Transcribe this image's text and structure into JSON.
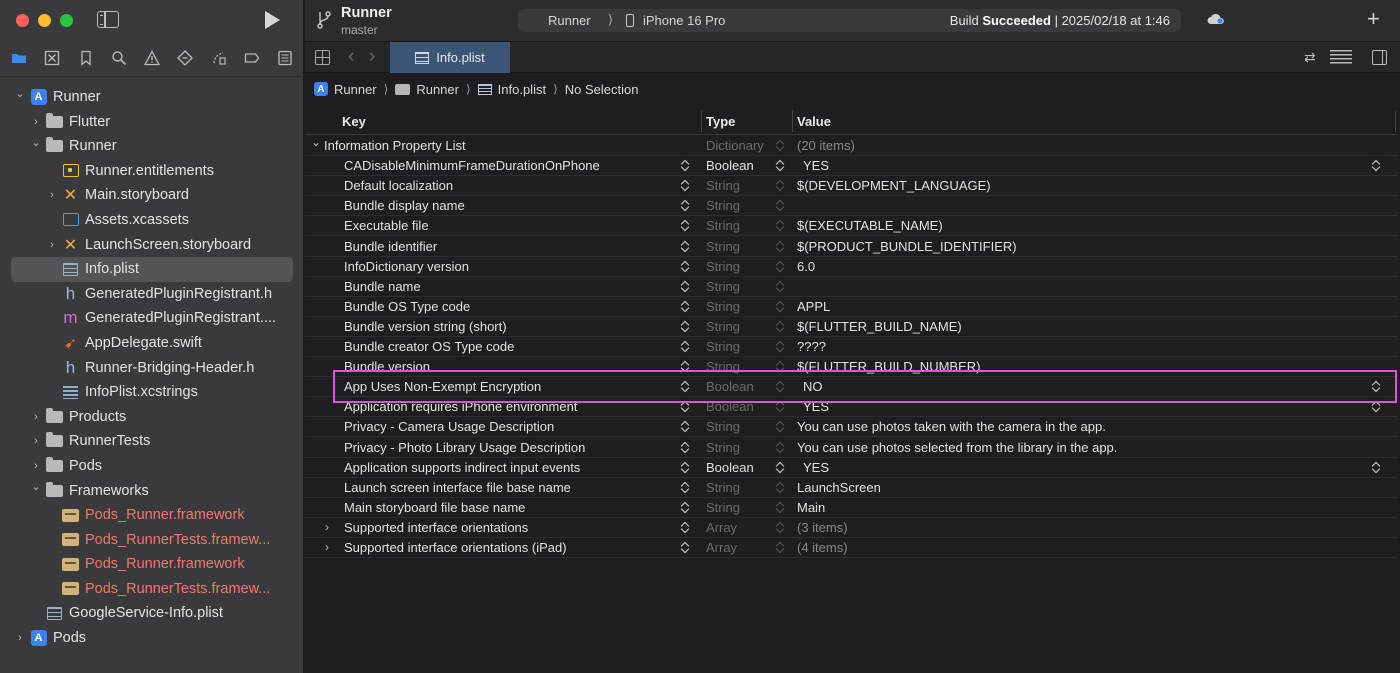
{
  "toolbar": {
    "project_name": "Runner",
    "branch": "master",
    "scheme": "Runner",
    "scheme_separator": "⟩",
    "device": "iPhone 16 Pro",
    "build_prefix": "Build ",
    "build_result": "Succeeded",
    "build_suffix": " | 2025/02/18 at 1:46",
    "add_symbol": "+"
  },
  "tab": {
    "label": "Info.plist"
  },
  "breadcrumb": {
    "items": [
      "Runner",
      "Runner",
      "Info.plist",
      "No Selection"
    ],
    "separator": "⟩"
  },
  "tree": [
    {
      "label": "Runner",
      "icon": "project-icon",
      "chevron": "v"
    },
    {
      "label": "Flutter",
      "icon": "folder-icon",
      "chevron": ">"
    },
    {
      "label": "Runner",
      "icon": "folder-icon",
      "chevron": "v"
    },
    {
      "label": "Runner.entitlements",
      "icon": "entitlements-icon",
      "chevron": ""
    },
    {
      "label": "Main.storyboard",
      "icon": "storyboard-icon",
      "chevron": ">"
    },
    {
      "label": "Assets.xcassets",
      "icon": "assets-icon",
      "chevron": ""
    },
    {
      "label": "LaunchScreen.storyboard",
      "icon": "storyboard-icon",
      "chevron": ">"
    },
    {
      "label": "Info.plist",
      "icon": "plist-icon",
      "chevron": ""
    },
    {
      "label": "GeneratedPluginRegistrant.h",
      "icon": "header-file-icon",
      "chevron": ""
    },
    {
      "label": "GeneratedPluginRegistrant....",
      "icon": "objc-file-icon",
      "chevron": ""
    },
    {
      "label": "AppDelegate.swift",
      "icon": "swift-file-icon",
      "chevron": ""
    },
    {
      "label": "Runner-Bridging-Header.h",
      "icon": "header-file-icon",
      "chevron": ""
    },
    {
      "label": "InfoPlist.xcstrings",
      "icon": "string-catalog-icon",
      "chevron": ""
    },
    {
      "label": "Products",
      "icon": "folder-icon",
      "chevron": ">"
    },
    {
      "label": "RunnerTests",
      "icon": "folder-icon",
      "chevron": ">"
    },
    {
      "label": "Pods",
      "icon": "folder-icon",
      "chevron": ">"
    },
    {
      "label": "Frameworks",
      "icon": "folder-icon",
      "chevron": "v"
    },
    {
      "label": "Pods_Runner.framework",
      "icon": "framework-icon",
      "chevron": ""
    },
    {
      "label": "Pods_RunnerTests.framew...",
      "icon": "framework-icon",
      "chevron": ""
    },
    {
      "label": "Pods_Runner.framework",
      "icon": "framework-icon",
      "chevron": ""
    },
    {
      "label": "Pods_RunnerTests.framew...",
      "icon": "framework-icon",
      "chevron": ""
    },
    {
      "label": "GoogleService-Info.plist",
      "icon": "plist-icon",
      "chevron": ""
    },
    {
      "label": "Pods",
      "icon": "project-icon",
      "chevron": ">"
    }
  ],
  "plist": {
    "headers": {
      "key": "Key",
      "type": "Type",
      "value": "Value"
    },
    "rows": [
      {
        "key": "Information Property List",
        "type": "Dictionary",
        "value": "(20 items)"
      },
      {
        "key": "CADisableMinimumFrameDurationOnPhone",
        "type": "Boolean",
        "value": "YES"
      },
      {
        "key": "Default localization",
        "type": "String",
        "value": "$(DEVELOPMENT_LANGUAGE)"
      },
      {
        "key": "Bundle display name",
        "type": "String",
        "value": ""
      },
      {
        "key": "Executable file",
        "type": "String",
        "value": "$(EXECUTABLE_NAME)"
      },
      {
        "key": "Bundle identifier",
        "type": "String",
        "value": "$(PRODUCT_BUNDLE_IDENTIFIER)"
      },
      {
        "key": "InfoDictionary version",
        "type": "String",
        "value": "6.0"
      },
      {
        "key": "Bundle name",
        "type": "String",
        "value": ""
      },
      {
        "key": "Bundle OS Type code",
        "type": "String",
        "value": "APPL"
      },
      {
        "key": "Bundle version string (short)",
        "type": "String",
        "value": "$(FLUTTER_BUILD_NAME)"
      },
      {
        "key": "Bundle creator OS Type code",
        "type": "String",
        "value": "????"
      },
      {
        "key": "Bundle version",
        "type": "String",
        "value": "$(FLUTTER_BUILD_NUMBER)"
      },
      {
        "key": "App Uses Non-Exempt Encryption",
        "type": "Boolean",
        "value": "NO"
      },
      {
        "key": "Application requires iPhone environment",
        "type": "Boolean",
        "value": "YES"
      },
      {
        "key": "Privacy - Camera Usage Description",
        "type": "String",
        "value": "You can use photos taken with the camera in the app."
      },
      {
        "key": "Privacy - Photo Library Usage Description",
        "type": "String",
        "value": "You can use photos selected from the library in the app."
      },
      {
        "key": "Application supports indirect input events",
        "type": "Boolean",
        "value": "YES"
      },
      {
        "key": "Launch screen interface file base name",
        "type": "String",
        "value": "LaunchScreen"
      },
      {
        "key": "Main storyboard file base name",
        "type": "String",
        "value": "Main"
      },
      {
        "key": "Supported interface orientations",
        "type": "Array",
        "value": "(3 items)"
      },
      {
        "key": "Supported interface orientations (iPad)",
        "type": "Array",
        "value": "(4 items)"
      }
    ]
  },
  "colors": {
    "highlight": "#e34fe0",
    "tab_active": "#3b5577",
    "framework_text": "#ef7a6a",
    "accent_blue": "#3c82f6"
  }
}
